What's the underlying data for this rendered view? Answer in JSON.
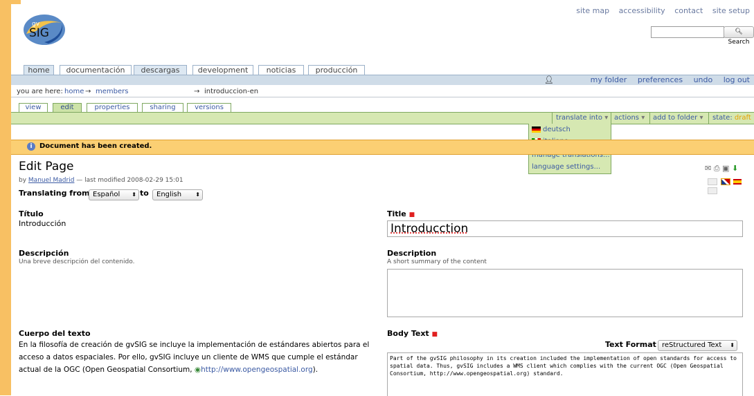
{
  "site_actions": [
    "site map",
    "accessibility",
    "contact",
    "site setup"
  ],
  "search": {
    "button": "Search",
    "value": ""
  },
  "logo": {
    "text": "SIG",
    "sup": "gv"
  },
  "global_tabs": [
    "home",
    "documentación",
    "descargas",
    "development",
    "noticias",
    "producción"
  ],
  "personal_tools": [
    "my folder",
    "preferences",
    "undo",
    "log out"
  ],
  "breadcrumb": {
    "prefix": "you are here:",
    "home": "home",
    "members": "members",
    "arrow": "→",
    "current": "introduccion-en"
  },
  "content_tabs": [
    "view",
    "edit",
    "properties",
    "sharing",
    "versions"
  ],
  "content_actions": {
    "translate": "translate into",
    "actions": "actions",
    "add_to_folder": "add to folder",
    "state_label": "state:",
    "state_value": "draft"
  },
  "translate_menu": {
    "deutsch": "deutsch",
    "italiano": "italiano",
    "manage": "manage translations...",
    "language_settings": "language settings..."
  },
  "message": "Document has been created.",
  "page_title": "Edit Page",
  "byline": {
    "author": "Manuel Madrid",
    "text": "— last modified 2008-02-29 15:01",
    "by": "by"
  },
  "translating": {
    "label": "Translating from",
    "from": "Español",
    "to_label": "to",
    "to": "English"
  },
  "left": {
    "title_label": "Título",
    "title_value": "Introducción",
    "desc_label": "Descripción",
    "desc_help": "Una breve descripción del contenido.",
    "body_label": "Cuerpo del texto",
    "body_text": "En la filosofía de creación de gvSIG se incluye la implementación de estándares abiertos para el acceso a datos espaciales. Por ello, gvSIG incluye un cliente de WMS que cumple el estándar actual de la OGC (Open Geospatial Consortium,",
    "body_link": "http://www.opengeospatial.org",
    "body_end": ")."
  },
  "right": {
    "title_label": "Title",
    "title_value": "Introducction",
    "desc_label": "Description",
    "desc_help": "A short summary of the content",
    "desc_value": "",
    "body_label": "Body Text",
    "format_label": "Text Format",
    "format_value": "reStructured Text",
    "body_value": "Part of the gvSIG philosophy in its creation included the implementation of open standards for access to spatial data. Thus, gvSIG includes a WMS client which complies with the current OGC (Open Geospatial Consortium, http://www.opengeospatial.org) standard."
  },
  "colors": {
    "frame": "#f8c063",
    "green_bar": "#d6e8b2",
    "message_bg": "#fbcf73",
    "link": "#3b5aa3",
    "required": "#e02020"
  }
}
